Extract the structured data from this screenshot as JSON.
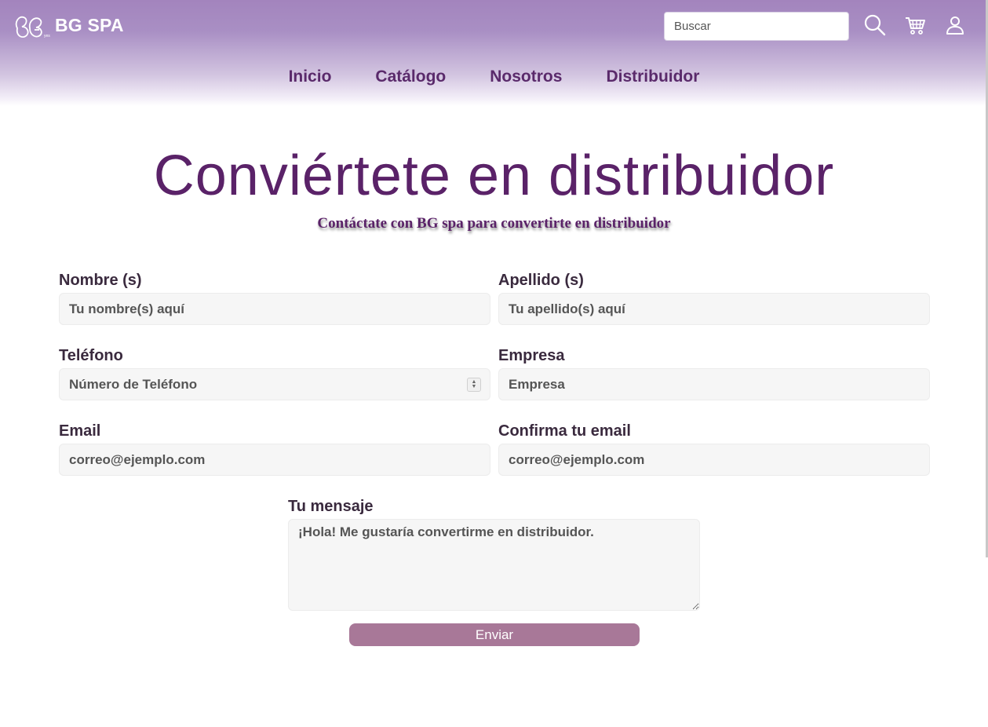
{
  "brand": {
    "name": "BG SPA"
  },
  "search": {
    "placeholder": "Buscar"
  },
  "header_icons": [
    "search-icon",
    "cart-icon",
    "user-icon"
  ],
  "nav": {
    "items": [
      "Inicio",
      "Catálogo",
      "Nosotros",
      "Distribuidor"
    ]
  },
  "page": {
    "title": "Conviértete en distribuidor",
    "subtitle": "Contáctate con BG spa para convertirte en distribuidor"
  },
  "form": {
    "first_name": {
      "label": "Nombre (s)",
      "placeholder": "Tu nombre(s) aquí"
    },
    "last_name": {
      "label": "Apellido (s)",
      "placeholder": "Tu apellido(s) aquí"
    },
    "phone": {
      "label": "Teléfono",
      "placeholder": "Número de Teléfono"
    },
    "company": {
      "label": "Empresa",
      "placeholder": "Empresa"
    },
    "email": {
      "label": "Email",
      "placeholder": "correo@ejemplo.com"
    },
    "email_confirm": {
      "label": "Confirma tu email",
      "placeholder": "correo@ejemplo.com"
    },
    "message": {
      "label": "Tu mensaje",
      "placeholder": "¡Hola! Me gustaría convertirme en distribuidor."
    },
    "submit_label": "Enviar"
  },
  "colors": {
    "header_purple": "#a384bd",
    "nav_text": "#5a2a6b",
    "title": "#5a2268",
    "button": "#a87898"
  }
}
